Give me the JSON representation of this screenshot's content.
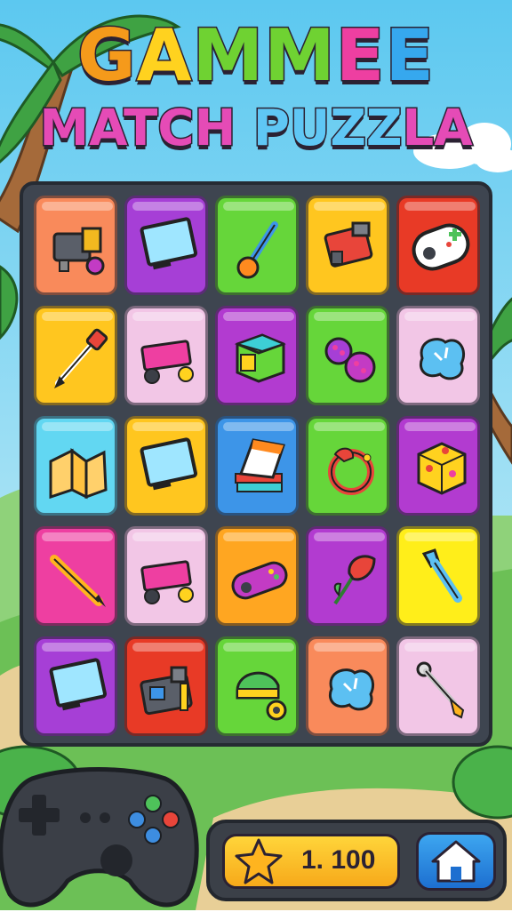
{
  "title": {
    "line1": [
      {
        "text": "G",
        "color": "#f59a1b"
      },
      {
        "text": "A",
        "color": "#ffd21f"
      },
      {
        "text": "M",
        "color": "#6fd232"
      },
      {
        "text": "M",
        "color": "#6fd232"
      },
      {
        "text": "E",
        "color": "#ee3fa1"
      },
      {
        "text": "E",
        "color": "#36a8ee"
      }
    ],
    "line2": [
      {
        "text": "MATCH ",
        "color": "#e54bb6"
      },
      {
        "text": "PUZZ",
        "color": "#5fc7f5"
      },
      {
        "text": "LA",
        "color": "#e54bb6"
      }
    ]
  },
  "tiles": [
    {
      "name": "gear-machine",
      "color": "#f98a5b",
      "icon": "gear-machine-icon"
    },
    {
      "name": "monitor",
      "color": "#a63fd6",
      "icon": "monitor-icon"
    },
    {
      "name": "joystick-lever",
      "color": "#66d63a",
      "icon": "joystick-lever-icon"
    },
    {
      "name": "engine-block",
      "color": "#ffc61f",
      "icon": "engine-block-icon"
    },
    {
      "name": "game-controller",
      "color": "#e83a26",
      "icon": "game-controller-icon"
    },
    {
      "name": "arrow-tool",
      "color": "#ffc61f",
      "icon": "arrow-tool-icon"
    },
    {
      "name": "cart",
      "color": "#f2c6e6",
      "icon": "cart-icon"
    },
    {
      "name": "box",
      "color": "#b23bd0",
      "icon": "box-icon"
    },
    {
      "name": "buttons",
      "color": "#66d63a",
      "icon": "buttons-icon"
    },
    {
      "name": "blue-blob",
      "color": "#f2c6e6",
      "icon": "blue-blob-icon"
    },
    {
      "name": "folded-paper",
      "color": "#62d7f2",
      "icon": "folded-paper-icon"
    },
    {
      "name": "monitor",
      "color": "#ffc61f",
      "icon": "monitor-icon"
    },
    {
      "name": "book-stack",
      "color": "#3d95e8",
      "icon": "book-stack-icon"
    },
    {
      "name": "bird-ring",
      "color": "#66d63a",
      "icon": "bird-ring-icon"
    },
    {
      "name": "yellow-cube",
      "color": "#b23bd0",
      "icon": "yellow-cube-icon"
    },
    {
      "name": "pen",
      "color": "#ee3fa1",
      "icon": "pen-icon"
    },
    {
      "name": "cart",
      "color": "#f2c6e6",
      "icon": "cart-icon"
    },
    {
      "name": "handheld-console",
      "color": "#ffa621",
      "icon": "handheld-console-icon"
    },
    {
      "name": "flower",
      "color": "#b23bd0",
      "icon": "flower-icon"
    },
    {
      "name": "blue-key",
      "color": "#ffee1a",
      "icon": "blue-key-icon"
    },
    {
      "name": "monitor",
      "color": "#a63fd6",
      "icon": "monitor-icon"
    },
    {
      "name": "robot-machine",
      "color": "#e83a26",
      "icon": "robot-machine-icon"
    },
    {
      "name": "helmet",
      "color": "#66d63a",
      "icon": "helmet-icon"
    },
    {
      "name": "blue-blob",
      "color": "#f98a5b",
      "icon": "blue-blob-icon"
    },
    {
      "name": "screwdriver",
      "color": "#f2c6e6",
      "icon": "screwdriver-icon"
    }
  ],
  "score": {
    "value": "1. 100",
    "icon": "star-icon"
  },
  "home_button": {
    "icon": "home-icon"
  },
  "decor": {
    "controller": "gamepad-icon"
  }
}
